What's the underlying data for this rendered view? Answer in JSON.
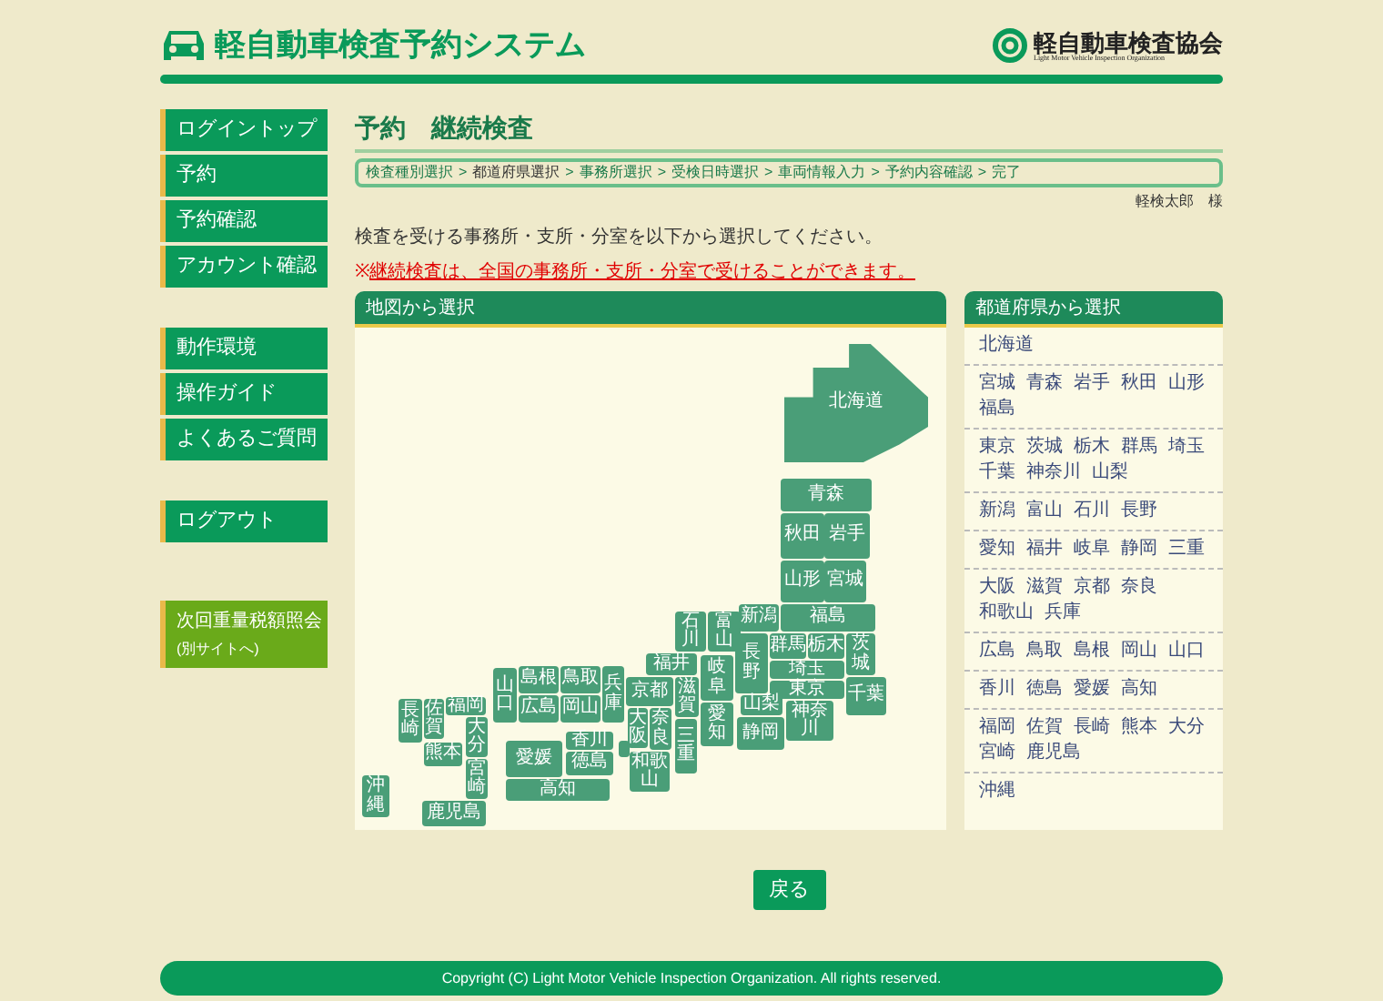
{
  "header": {
    "title": "軽自動車検査予約システム",
    "logo_name": "軽自動車検査協会",
    "logo_sub": "Light Motor Vehicle Inspection Organization"
  },
  "sidebar": {
    "groups": [
      {
        "items": [
          {
            "label": "ログイントップ"
          },
          {
            "label": "予約"
          },
          {
            "label": "予約確認"
          },
          {
            "label": "アカウント確認"
          }
        ]
      },
      {
        "items": [
          {
            "label": "動作環境"
          },
          {
            "label": "操作ガイド"
          },
          {
            "label": "よくあるご質問"
          }
        ]
      },
      {
        "items": [
          {
            "label": "ログアウト"
          }
        ]
      }
    ],
    "external": {
      "label": "次回重量税額照会",
      "note": "(別サイトへ)"
    }
  },
  "page_title": "予約　継続検査",
  "steps": [
    {
      "label": "検査種別選択",
      "selected": false
    },
    {
      "label": "都道府県選択",
      "selected": true
    },
    {
      "label": "事務所選択",
      "selected": false
    },
    {
      "label": "受検日時選択",
      "selected": false
    },
    {
      "label": "車両情報入力",
      "selected": false
    },
    {
      "label": "予約内容確認",
      "selected": false
    },
    {
      "label": "完了",
      "selected": false
    }
  ],
  "step_separator": ">",
  "user": "軽検太郎　様",
  "instruction": "検査を受ける事務所・支所・分室を以下から選択してください。",
  "notice_mark": "※",
  "notice": "継続検査は、全国の事務所・支所・分室で受けることができます。",
  "map_panel": {
    "title": "地図から選択",
    "prefectures": [
      "北海道",
      "青森",
      "秋田",
      "岩手",
      "山形",
      "宮城",
      "石川",
      "富山",
      "新潟",
      "福島",
      "長野",
      "群馬",
      "栃木",
      "埼玉",
      "茨城",
      "東京",
      "山梨",
      "神奈川",
      "千葉",
      "静岡",
      "島根",
      "鳥取",
      "兵庫",
      "京都",
      "福井",
      "岐阜",
      "和歌山",
      "山口",
      "広島",
      "岡山",
      "大阪",
      "奈良",
      "滋賀",
      "三重",
      "愛知",
      "高知",
      "愛媛",
      "香川",
      "徳島",
      "長崎",
      "佐賀",
      "福岡",
      "熊本",
      "沖縄",
      "大分",
      "宮崎",
      "鹿児島"
    ]
  },
  "list_panel": {
    "title": "都道府県から選択",
    "regions": [
      [
        "北海道"
      ],
      [
        "宮城",
        "青森",
        "岩手",
        "秋田",
        "山形",
        "福島"
      ],
      [
        "東京",
        "茨城",
        "栃木",
        "群馬",
        "埼玉",
        "千葉",
        "神奈川",
        "山梨"
      ],
      [
        "新潟",
        "富山",
        "石川",
        "長野"
      ],
      [
        "愛知",
        "福井",
        "岐阜",
        "静岡",
        "三重"
      ],
      [
        "大阪",
        "滋賀",
        "京都",
        "奈良",
        "和歌山",
        "兵庫"
      ],
      [
        "広島",
        "鳥取",
        "島根",
        "岡山",
        "山口"
      ],
      [
        "香川",
        "徳島",
        "愛媛",
        "高知"
      ],
      [
        "福岡",
        "佐賀",
        "長崎",
        "熊本",
        "大分",
        "宮崎",
        "鹿児島"
      ],
      [
        "沖縄"
      ]
    ]
  },
  "back_button": "戻る",
  "footer": "Copyright (C) Light Motor Vehicle Inspection Organization. All rights reserved."
}
